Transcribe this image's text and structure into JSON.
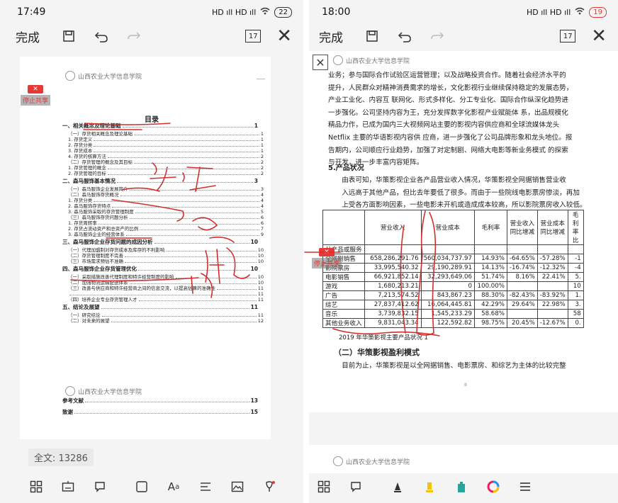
{
  "left": {
    "status": {
      "time": "17:49",
      "signal": "HD ıll HD ıll",
      "wifi": "wifi",
      "battery": "22"
    },
    "toolbar": {
      "done_label": "完成",
      "page_label": "17"
    },
    "logo_text": "山西农业大学信息学院",
    "stop_button_label": "停止共享",
    "toc": {
      "title": "目录",
      "lines": [
        {
          "t": "一、相关概念及理论基础",
          "p": "1",
          "h1": true
        },
        {
          "t": "（一）存货相关概念及理论基础",
          "p": "1"
        },
        {
          "t": "1. 存货定义",
          "p": "1"
        },
        {
          "t": "2. 存货分类",
          "p": "1"
        },
        {
          "t": "3. 存货成本",
          "p": "1"
        },
        {
          "t": "4. 存货的核算方法",
          "p": "2"
        },
        {
          "t": "（二）存货管理的概念及其目标",
          "p": "2"
        },
        {
          "t": "1. 存货管理的概念",
          "p": "2"
        },
        {
          "t": "2. 存货管理的目标",
          "p": "2"
        },
        {
          "t": "二、森马服饰基本情况",
          "p": "3",
          "h1": true
        },
        {
          "t": "（一）森马服饰企业发展简介",
          "p": "3"
        },
        {
          "t": "（二）森马服饰存货概况",
          "p": "4"
        },
        {
          "t": "1. 存货分类",
          "p": "4"
        },
        {
          "t": "2. 森马服饰存货特点",
          "p": "4"
        },
        {
          "t": "3. 森马服饰采取的存货管理制度",
          "p": "5"
        },
        {
          "t": "（三）森马服饰存货问题分析",
          "p": "6"
        },
        {
          "t": "1. 存货周转率",
          "p": "6"
        },
        {
          "t": "2. 存货占流动资产和总资产的比例",
          "p": "7"
        },
        {
          "t": "3. 森马服饰企业的经营体系",
          "p": "9"
        },
        {
          "t": "三、森马服饰企业存货问题的成因分析",
          "p": "10",
          "h1": true
        },
        {
          "t": "（一）代理加盟制对存货成本及库存的不利影响",
          "p": "10"
        },
        {
          "t": "（二）存货管理制度不完善",
          "p": "10"
        },
        {
          "t": "（三）市场需求预估不准确",
          "p": "10"
        },
        {
          "t": "四、森马服饰企业存货管理优化",
          "p": "10",
          "h1": true
        },
        {
          "t": "（一）采取措施改善代理制度和特许经营制度的影响",
          "p": "10"
        },
        {
          "t": "（二）加强物流运输配送体系",
          "p": "10"
        },
        {
          "t": "（三）改善与供应商和特许经营商之间的信息交流，以提高估算的准确性",
          "p": "11"
        },
        {
          "t": "",
          "p": "11"
        },
        {
          "t": "（四）培养企业专业存货管理人才",
          "p": "11"
        },
        {
          "t": "五、结论及展望",
          "p": "11",
          "h1": true
        },
        {
          "t": "（一）研究结论",
          "p": "11"
        },
        {
          "t": "（二）对未来的展望",
          "p": "12"
        }
      ],
      "refs": [
        {
          "t": "参考文献",
          "p": "13"
        },
        {
          "t": "致谢",
          "p": "15"
        }
      ]
    },
    "fulltext_label": "全文: 13286"
  },
  "right": {
    "status": {
      "time": "18:00",
      "signal": "HD ıll HD ıll",
      "wifi": "wifi",
      "battery": "19"
    },
    "toolbar": {
      "done_label": "完成",
      "page_label": "17"
    },
    "logo_text": "山西农业大学信息学院",
    "stop_button_label": "停止共享",
    "paragraphs": [
      "业务；参与国际合作试验区运营管理；以及战略投资合作。随着社会经济水平的",
      "提升，人民群众对精神消费需求的增长，文化影视行业继续保持稳定的发展态势，",
      "产业工业化、内容互 联网化、形式多样化、分工专业化、国际合作纵深化趋势进",
      "一步强化。公司坚持内容为王，充分发挥数字化影视产业赋能体 系，出品规模化",
      "精品力作，已成为国内三大视频网站主要的影视内容供应商和全球流媒体龙头",
      "Netflix 主要的华语影视内容供 应商，进一步强化了公司品牌形象和龙头地位。报",
      "告期内，公司顺应行业趋势，加强了对定制剧、网络大电影等新业务模式 的探索",
      "与开发，进一步丰富内容矩阵。"
    ],
    "section5_title": "5.产品状况",
    "paragraphs2": [
      "由表可知，华策影视企业各产品营业收入情况，华策影视全网据销售营业收",
      "入远高于其他产品，但比去年要低了很多。而由于一些院线电影票房惨淡，再加",
      "上受各方面影响因素，一些电影未开机或造成成本较高，所以影院票房收入较低。"
    ],
    "table": {
      "headers": [
        "",
        "营业收入",
        "营业成本",
        "毛利率",
        "营业收入同比增减",
        "营业成本同比增减",
        "毛利率比"
      ],
      "rows": [
        [
          "分产品或服务",
          "",
          "",
          "",
          "",
          "",
          ""
        ],
        [
          "全网剧销售",
          "658,286,291.76",
          "560,034,737.97",
          "14.93%",
          "-64.65%",
          "-57.28%",
          "-1"
        ],
        [
          "影院票房",
          "33,995,540.32",
          "29,190,289.91",
          "14.13%",
          "-16.74%",
          "-12.32%",
          "-4"
        ],
        [
          "电影销售",
          "66,921,852.14",
          "32,293,649.06",
          "51.74%",
          "8.16%",
          "22.41%",
          "5."
        ],
        [
          "游戏",
          "1,680,213.21",
          "0",
          "100.00%",
          "",
          "",
          "10"
        ],
        [
          "广告",
          "7,213,574.52",
          "843,867.23",
          "88.30%",
          "-82.43%",
          "-83.92%",
          "1."
        ],
        [
          "综艺",
          "27,837,412.62",
          "16,064,445.81",
          "42.29%",
          "29.64%",
          "22.98%",
          "3."
        ],
        [
          "音乐",
          "3,739,832.15",
          "1,545,233.29",
          "58.68%",
          "",
          "",
          "58"
        ],
        [
          "其他业务收入",
          "9,831,043.34",
          "122,592.82",
          "98.75%",
          "20.45%",
          "-12.67%",
          "0."
        ]
      ]
    },
    "caption": "2019 年华策影视主要产品状况 1",
    "subsection_title": "（二）华策影视盈利模式",
    "paragraph3": "目前为止，华策影视是以全网据销售、电影票房、和综艺为主体的比较完整",
    "page_number": "8"
  }
}
